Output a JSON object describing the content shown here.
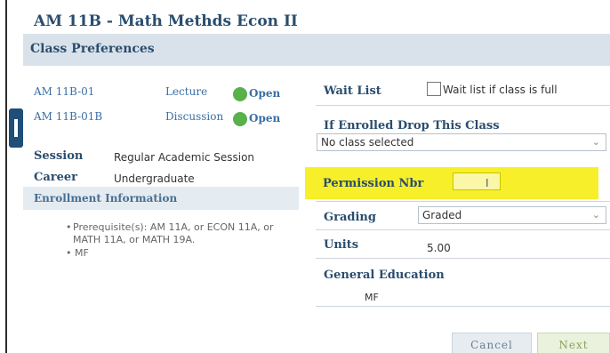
{
  "course": {
    "title": "AM  11B - Math Methds Econ II"
  },
  "preferences": {
    "title": "Class Preferences"
  },
  "sections": [
    {
      "id": "AM  11B-01",
      "type": "Lecture",
      "status": "Open"
    },
    {
      "id": "AM  11B-01B",
      "type": "Discussion",
      "status": "Open"
    }
  ],
  "session": {
    "label": "Session",
    "value": "Regular Academic Session"
  },
  "career": {
    "label": "Career",
    "value": "Undergraduate"
  },
  "enrollment": {
    "title": "Enrollment Information",
    "prerequisite": "Prerequisite(s): AM 11A, or ECON 11A, or MATH 11A, or MATH 19A.",
    "mf": "MF"
  },
  "wait_list": {
    "label": "Wait List",
    "checkbox_label": "Wait list if class is full",
    "checked": false
  },
  "drop_class": {
    "label": "If Enrolled Drop This Class",
    "value": "No class selected"
  },
  "permission": {
    "label": "Permission Nbr",
    "value": ""
  },
  "grading": {
    "label": "Grading",
    "value": "Graded"
  },
  "units": {
    "label": "Units",
    "value": "5.00"
  },
  "general_education": {
    "label": "General Education",
    "value": "MF"
  },
  "buttons": {
    "cancel": "Cancel",
    "next": "Next"
  },
  "colors": {
    "accent": "#2a4d6e",
    "open_status": "#58b14b",
    "highlight": "#f6ef2a"
  },
  "icons": {
    "status": "open-dot-icon",
    "dropdown": "chevron-down-icon",
    "text_cursor": "text-cursor-icon"
  }
}
